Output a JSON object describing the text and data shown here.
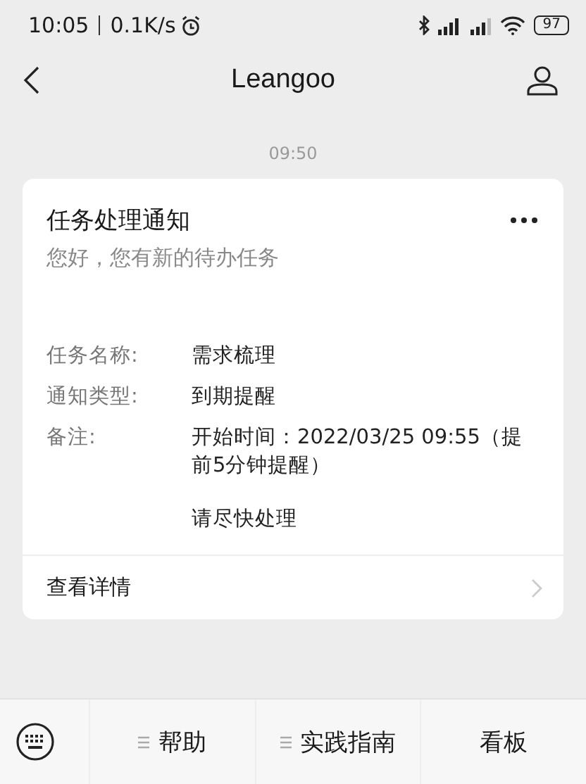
{
  "status_bar": {
    "time": "10:05",
    "speed": "0.1K/s",
    "battery": "97"
  },
  "nav": {
    "title": "Leangoo"
  },
  "timestamp": "09:50",
  "card": {
    "title": "任务处理通知",
    "subtitle": "您好，您有新的待办任务",
    "fields": [
      {
        "label": "任务名称:",
        "value": [
          "需求梳理"
        ]
      },
      {
        "label": "通知类型:",
        "value": [
          "到期提醒"
        ]
      },
      {
        "label": "备注:",
        "value": [
          "开始时间：2022/03/25 09:55（提前5分钟提醒）",
          "请尽快处理"
        ]
      }
    ],
    "link": "查看详情"
  },
  "menu": [
    {
      "label": "帮助",
      "has_submenu": true
    },
    {
      "label": "实践指南",
      "has_submenu": true
    },
    {
      "label": "看板",
      "has_submenu": false
    }
  ]
}
